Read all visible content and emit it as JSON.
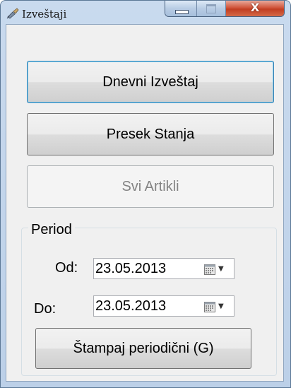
{
  "window": {
    "title": "Izveštaji"
  },
  "caption": {
    "close_glyph": "X"
  },
  "buttons": {
    "daily": "Dnevni Izveštaj",
    "cross_section": "Presek Stanja",
    "all_items": "Svi Artikli",
    "print_periodic": "Štampaj periodični (G)"
  },
  "period": {
    "legend": "Period",
    "from_label": "Od:",
    "from_value": "23.05.2013",
    "to_label": "Do:",
    "to_value": "23.05.2013"
  },
  "icons": {
    "app": "broom-icon",
    "calendar": "calendar-icon",
    "dropdown": "dropdown-arrow-icon"
  }
}
